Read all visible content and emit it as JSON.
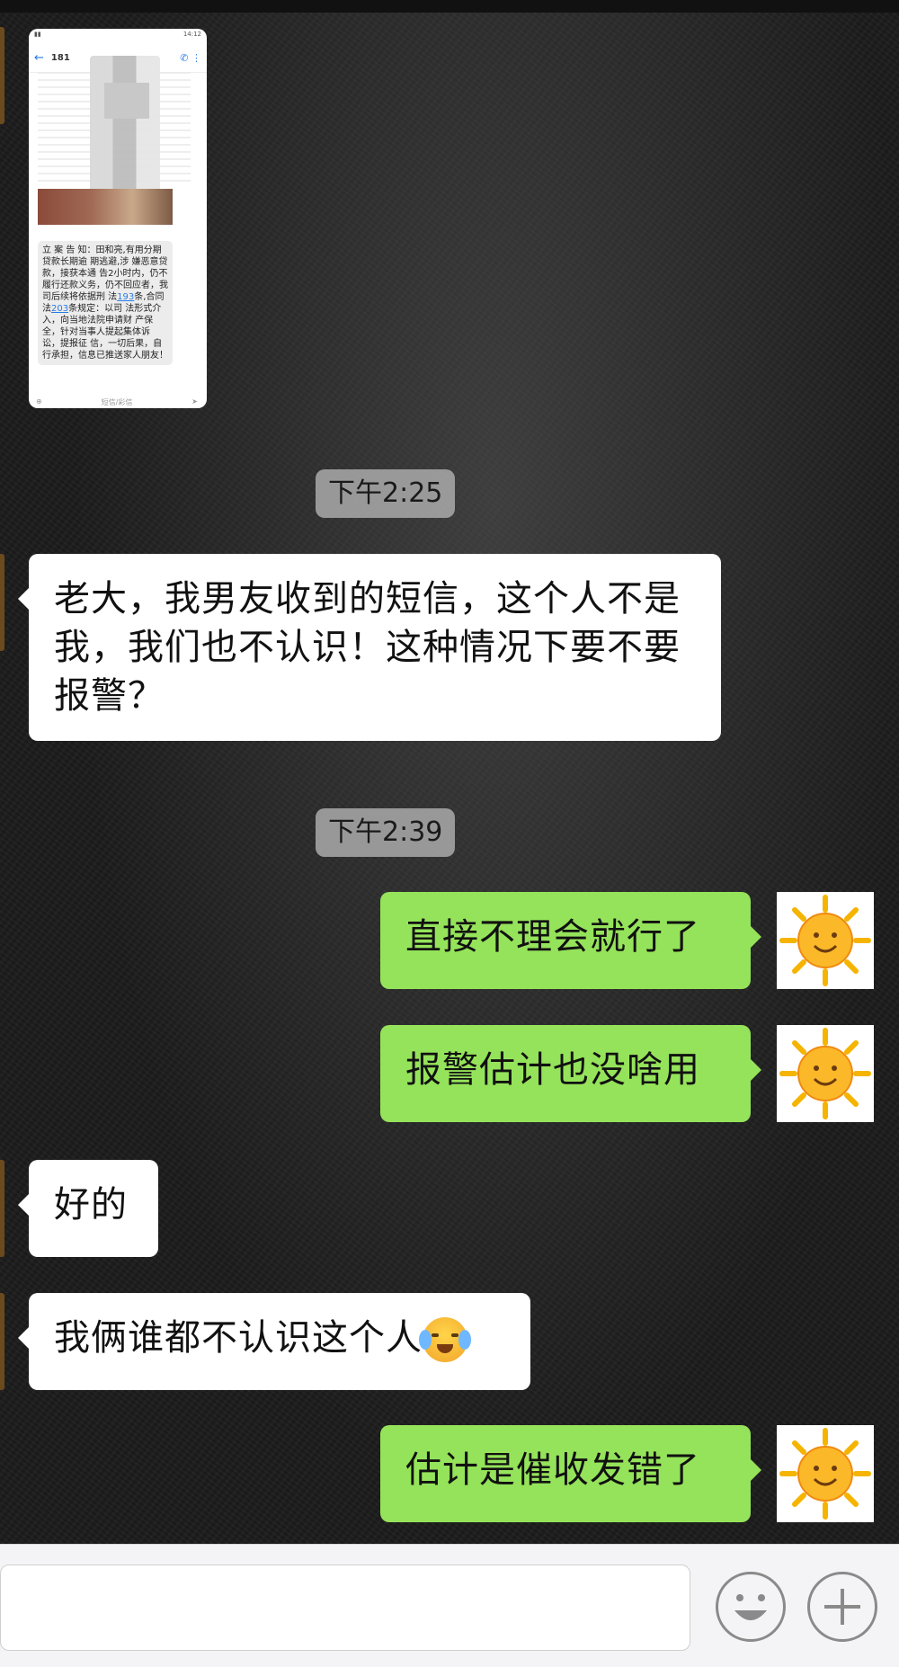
{
  "thumbnail": {
    "status_time": "14:12",
    "contact_number": "181",
    "sms_text_parts": [
      "立 案 告 知：田和亮,有用分期贷款长期逾 期逃避,涉 嫌恶意贷 款，接获本通 告2小时内，仍不履行还款义务，仍不回应者，我司后续将依据刑 法",
      "193",
      "条,合同 法",
      "203",
      "条规定：以司 法形式介入，向当地法院申请财 产保 全，针对当事人提起集体诉 讼，提报征 信，一切后果，自行承担，信息已推送家人朋友！"
    ],
    "input_placeholder": "短信/彩信"
  },
  "messages": [
    {
      "type": "timestamp",
      "text": "下午2:25"
    },
    {
      "type": "incoming",
      "text": "老大，我男友收到的短信，这个人不是我，我们也不认识！这种情况下要不要报警？"
    },
    {
      "type": "timestamp",
      "text": "下午2:39"
    },
    {
      "type": "outgoing",
      "text": "直接不理会就行了"
    },
    {
      "type": "outgoing",
      "text": "报警估计也没啥用"
    },
    {
      "type": "incoming",
      "text": "好的"
    },
    {
      "type": "incoming",
      "text": "我俩谁都不认识这个人",
      "emoji": "crying-laughing-emoji"
    },
    {
      "type": "outgoing",
      "text": "估计是催收发错了"
    }
  ],
  "icons": {
    "self_avatar": "sun-avatar-icon",
    "emoji_button": "smiley-icon",
    "more_button": "plus-icon"
  },
  "colors": {
    "outgoing_bubble": "#95e35a",
    "incoming_bubble": "#ffffff",
    "timestamp_bg": "#aaaaaa"
  }
}
